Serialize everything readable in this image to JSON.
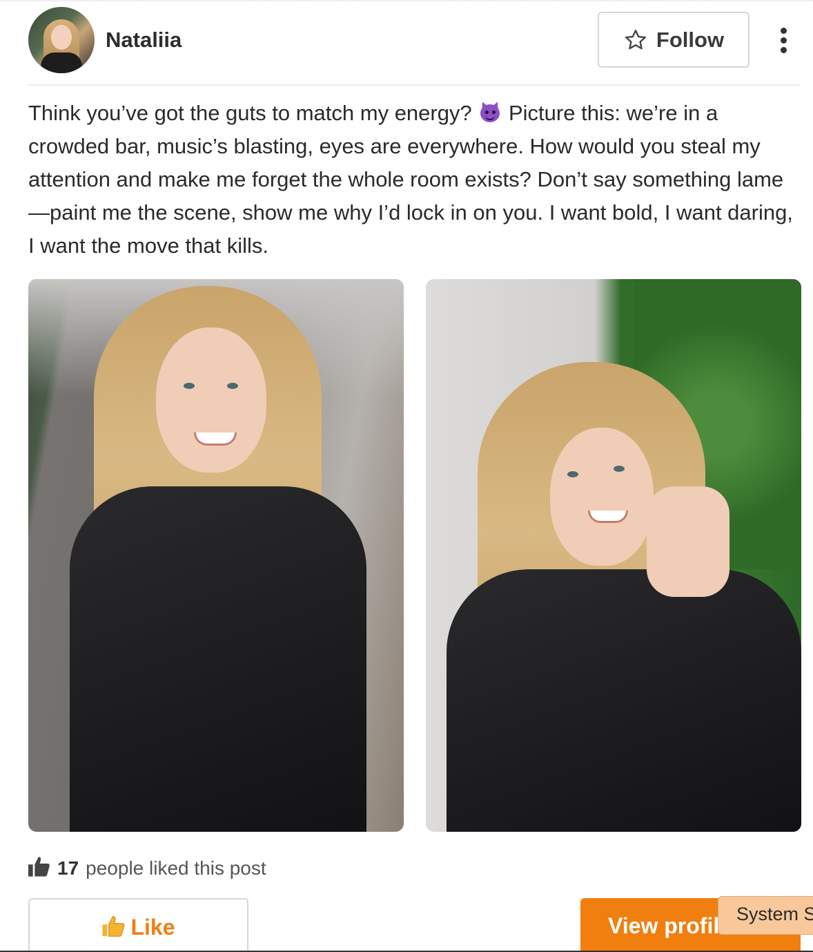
{
  "header": {
    "username": "Nataliia",
    "follow_label": "Follow",
    "avatar_alt": "",
    "icons": {
      "follow": "star-outline-icon",
      "more": "more-vertical-icon"
    }
  },
  "post": {
    "text_before_emoji": "Think you’ve got the guts to match my energy?",
    "emoji": "smiling-devil-emoji",
    "text_after_emoji": "Picture this: we’re in a crowded bar, music’s blasting, eyes are everywhere. How would you steal my attention and make me forget the whole room exists? Don’t say something lame—paint me the scene, show me why I’d lock in on you. I want bold, I want daring, I want the move that kills.",
    "photos": [
      {
        "name": "post-photo-1"
      },
      {
        "name": "post-photo-2"
      }
    ]
  },
  "likes": {
    "count": "17",
    "text": "people liked this post",
    "icon": "thumbs-up-icon"
  },
  "actions": {
    "like_label": "Like",
    "like_icon": "thumbs-up-emoji-icon",
    "view_profile_label": "View profile"
  },
  "tooltip": {
    "text": "System S"
  },
  "colors": {
    "accent": "#f07f10",
    "text": "#2a2a2a",
    "border": "#d6d6d6",
    "tooltip_bg": "#f8c89b"
  }
}
